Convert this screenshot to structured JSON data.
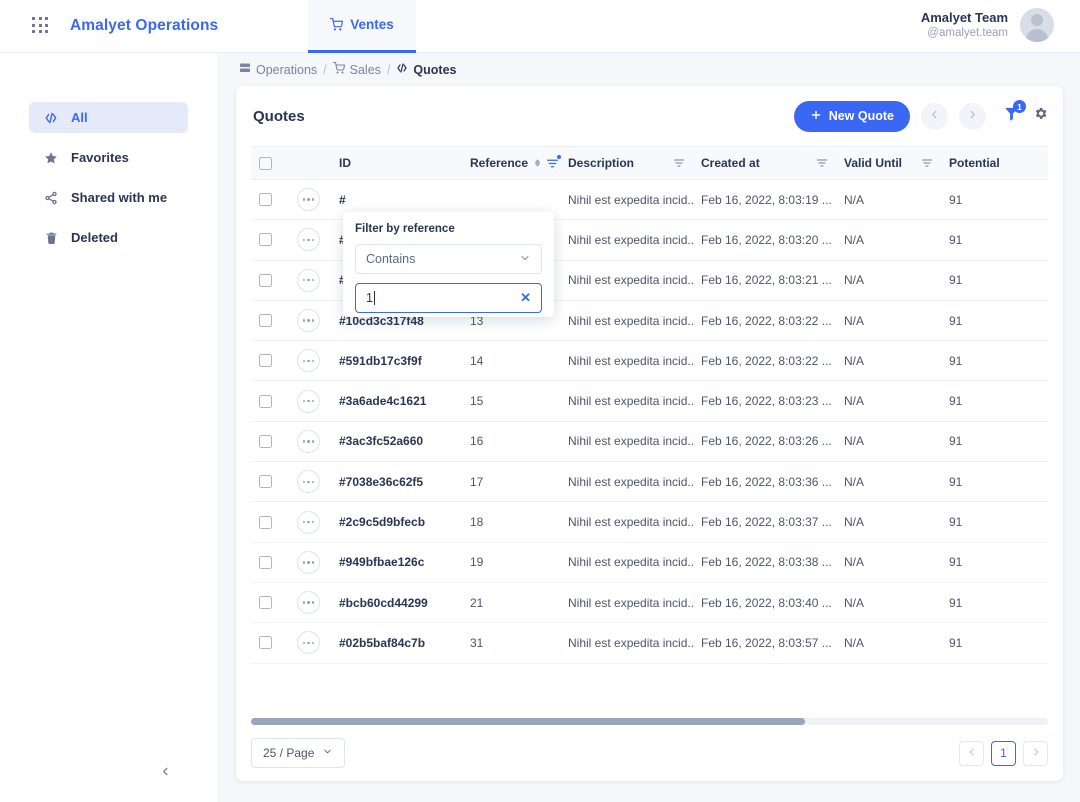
{
  "topbar": {
    "apps_icon": "grid-apps-icon",
    "brand": "Amalyet Operations",
    "tab": {
      "label": "Ventes",
      "icon": "cart-icon"
    },
    "user": {
      "name": "Amalyet Team",
      "handle": "@amalyet.team",
      "avatar": "user-avatar"
    }
  },
  "sidebar": {
    "items": [
      {
        "label": "All",
        "icon": "code-slash-icon",
        "active": true
      },
      {
        "label": "Favorites",
        "icon": "star-icon",
        "active": false
      },
      {
        "label": "Shared with me",
        "icon": "share-icon",
        "active": false
      },
      {
        "label": "Deleted",
        "icon": "trash-icon",
        "active": false
      }
    ],
    "collapse_icon": "chevron-left-icon"
  },
  "breadcrumb": [
    {
      "label": "Operations",
      "icon": "server-icon"
    },
    {
      "label": "Sales",
      "icon": "cart-icon"
    },
    {
      "label": "Quotes",
      "icon": "code-slash-icon",
      "current": true
    }
  ],
  "card": {
    "title": "Quotes",
    "new_button": {
      "label": "New Quote",
      "icon": "plus-icon"
    },
    "prev_icon": "chevron-left-icon",
    "next_icon": "chevron-right-icon",
    "filter_indicator": {
      "icon": "funnel-icon",
      "badge": "1"
    },
    "settings_icon": "gear-icon"
  },
  "table": {
    "columns": [
      {
        "key": "checkbox",
        "label": "",
        "filter": false,
        "sortable": false
      },
      {
        "key": "menu",
        "label": "",
        "filter": false,
        "sortable": false
      },
      {
        "key": "id",
        "label": "ID",
        "filter": false,
        "sortable": false
      },
      {
        "key": "reference",
        "label": "Reference",
        "filter": true,
        "sortable": true,
        "filter_active": true
      },
      {
        "key": "description",
        "label": "Description",
        "filter": true,
        "sortable": false
      },
      {
        "key": "created_at",
        "label": "Created at",
        "filter": true,
        "sortable": false
      },
      {
        "key": "valid_until",
        "label": "Valid Until",
        "filter": true,
        "sortable": false
      },
      {
        "key": "potential",
        "label": "Potential",
        "filter": true,
        "sortable": false
      }
    ],
    "rows": [
      {
        "id": "#",
        "reference": "",
        "description": "Nihil est expedita incid...",
        "created_at": "Feb 16, 2022, 8:03:19 ...",
        "valid_until": "N/A",
        "potential": "91"
      },
      {
        "id": "#",
        "reference": "",
        "description": "Nihil est expedita incid...",
        "created_at": "Feb 16, 2022, 8:03:20 ...",
        "valid_until": "N/A",
        "potential": "91"
      },
      {
        "id": "#",
        "reference": "",
        "description": "Nihil est expedita incid...",
        "created_at": "Feb 16, 2022, 8:03:21 ...",
        "valid_until": "N/A",
        "potential": "91"
      },
      {
        "id": "#10cd3c317f48",
        "reference": "13",
        "description": "Nihil est expedita incid...",
        "created_at": "Feb 16, 2022, 8:03:22 ...",
        "valid_until": "N/A",
        "potential": "91"
      },
      {
        "id": "#591db17c3f9f",
        "reference": "14",
        "description": "Nihil est expedita incid...",
        "created_at": "Feb 16, 2022, 8:03:22 ...",
        "valid_until": "N/A",
        "potential": "91"
      },
      {
        "id": "#3a6ade4c1621",
        "reference": "15",
        "description": "Nihil est expedita incid...",
        "created_at": "Feb 16, 2022, 8:03:23 ...",
        "valid_until": "N/A",
        "potential": "91"
      },
      {
        "id": "#3ac3fc52a660",
        "reference": "16",
        "description": "Nihil est expedita incid...",
        "created_at": "Feb 16, 2022, 8:03:26 ...",
        "valid_until": "N/A",
        "potential": "91"
      },
      {
        "id": "#7038e36c62f5",
        "reference": "17",
        "description": "Nihil est expedita incid...",
        "created_at": "Feb 16, 2022, 8:03:36 ...",
        "valid_until": "N/A",
        "potential": "91"
      },
      {
        "id": "#2c9c5d9bfecb",
        "reference": "18",
        "description": "Nihil est expedita incid...",
        "created_at": "Feb 16, 2022, 8:03:37 ...",
        "valid_until": "N/A",
        "potential": "91"
      },
      {
        "id": "#949bfbae126c",
        "reference": "19",
        "description": "Nihil est expedita incid...",
        "created_at": "Feb 16, 2022, 8:03:38 ...",
        "valid_until": "N/A",
        "potential": "91"
      },
      {
        "id": "#bcb60cd44299",
        "reference": "21",
        "description": "Nihil est expedita incid...",
        "created_at": "Feb 16, 2022, 8:03:40 ...",
        "valid_until": "N/A",
        "potential": "91"
      },
      {
        "id": "#02b5baf84c7b",
        "reference": "31",
        "description": "Nihil est expedita incid...",
        "created_at": "Feb 16, 2022, 8:03:57 ...",
        "valid_until": "N/A",
        "potential": "91"
      }
    ]
  },
  "filter_popup": {
    "title": "Filter by reference",
    "operator": "Contains",
    "operator_chevron": "chevron-down-icon",
    "value": "1",
    "clear_icon": "clear-x-icon"
  },
  "footer": {
    "page_size": "25 / Page",
    "page_size_chevron": "chevron-down-icon",
    "prev_icon": "chevron-left-icon",
    "next_icon": "chevron-right-icon",
    "current_page": "1"
  },
  "colors": {
    "accent": "#3b67f5",
    "page_bg": "#f5f7fb",
    "text_dark": "#2a3553",
    "text_muted": "#7a849c"
  }
}
